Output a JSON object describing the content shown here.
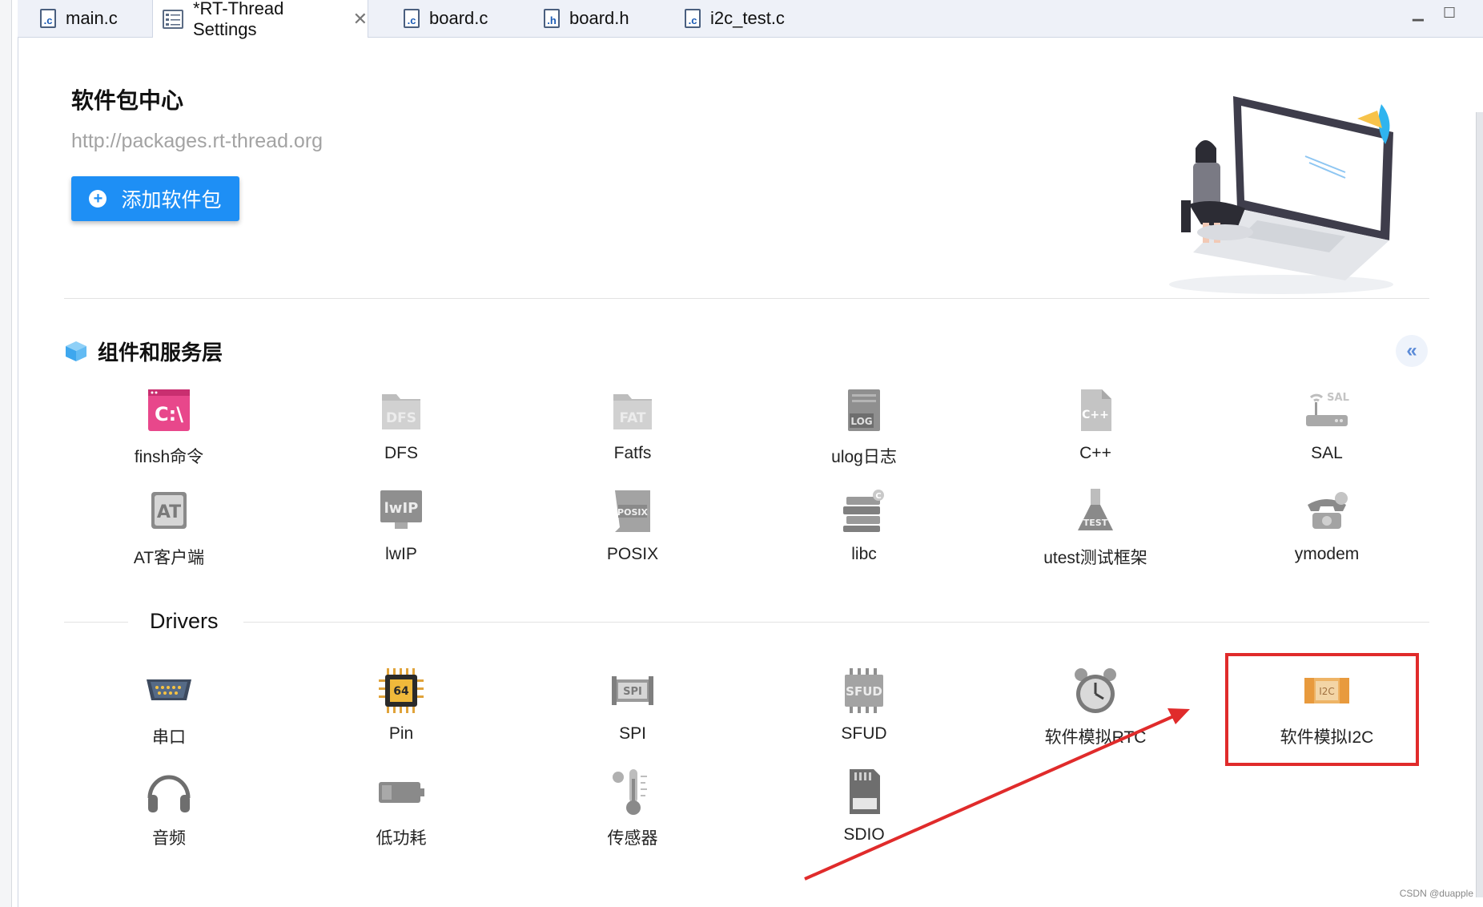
{
  "tabs": [
    {
      "label": "main.c",
      "type": "c"
    },
    {
      "label": "*RT-Thread Settings",
      "type": "settings",
      "active": true
    },
    {
      "label": "board.c",
      "type": "c"
    },
    {
      "label": "board.h",
      "type": "h"
    },
    {
      "label": "i2c_test.c",
      "type": "c"
    }
  ],
  "package_center": {
    "title": "软件包中心",
    "url": "http://packages.rt-thread.org",
    "add_button": "添加软件包"
  },
  "components": {
    "title": "组件和服务层",
    "items": [
      {
        "label": "finsh命令",
        "icon": "terminal-icon"
      },
      {
        "label": "DFS",
        "icon": "folder-icon"
      },
      {
        "label": "Fatfs",
        "icon": "folder-icon"
      },
      {
        "label": "ulog日志",
        "icon": "log-file-icon"
      },
      {
        "label": "C++",
        "icon": "cpp-file-icon"
      },
      {
        "label": "SAL",
        "icon": "router-icon"
      },
      {
        "label": "AT客户端",
        "icon": "at-icon"
      },
      {
        "label": "lwIP",
        "icon": "lwip-icon"
      },
      {
        "label": "POSIX",
        "icon": "posix-icon"
      },
      {
        "label": "libc",
        "icon": "books-icon"
      },
      {
        "label": "utest测试框架",
        "icon": "flask-icon"
      },
      {
        "label": "ymodem",
        "icon": "telephone-icon"
      }
    ]
  },
  "drivers": {
    "title": "Drivers",
    "items": [
      {
        "label": "串口",
        "icon": "serial-port-icon"
      },
      {
        "label": "Pin",
        "icon": "chip-icon"
      },
      {
        "label": "SPI",
        "icon": "spi-icon"
      },
      {
        "label": "SFUD",
        "icon": "sfud-icon"
      },
      {
        "label": "软件模拟RTC",
        "icon": "alarm-clock-icon"
      },
      {
        "label": "软件模拟I2C",
        "icon": "i2c-icon"
      },
      {
        "label": "音频",
        "icon": "headphones-icon"
      },
      {
        "label": "低功耗",
        "icon": "battery-icon"
      },
      {
        "label": "传感器",
        "icon": "thermometer-icon"
      },
      {
        "label": "SDIO",
        "icon": "sd-card-icon"
      }
    ]
  },
  "watermark": "CSDN @duapple",
  "colors": {
    "accent": "#1e8ff5",
    "highlight": "#e02b2b",
    "pink": "#e8478b"
  }
}
